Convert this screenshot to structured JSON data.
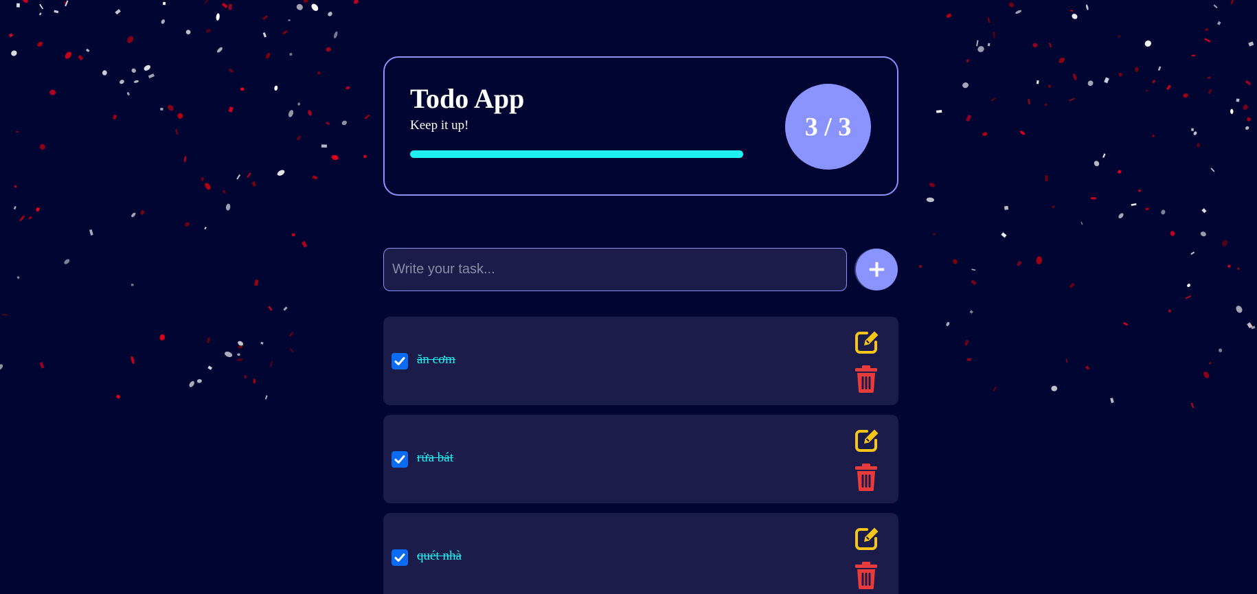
{
  "header": {
    "title": "Todo App",
    "subtitle": "Keep it up!",
    "progress_fraction": 1.0,
    "counter": "3 / 3"
  },
  "input": {
    "placeholder": "Write your task...",
    "value": "",
    "add_label": "+"
  },
  "tasks": [
    {
      "text": "ăn cơm",
      "done": true
    },
    {
      "text": "rửa bát",
      "done": true
    },
    {
      "text": "quét nhà",
      "done": true
    }
  ],
  "colors": {
    "background": "#000532",
    "accent": "#8b93ff",
    "done_text": "#1ff0f0",
    "progress": "#1ff0f0",
    "panel": "#1b1c4a",
    "edit_icon": "#f5c518",
    "delete_icon": "#e83b3b",
    "checkbox": "#0a6cf5",
    "confetti": [
      "#ffffff",
      "#c8c8d0",
      "#b00010",
      "#e3001b",
      "#7a0010"
    ]
  }
}
